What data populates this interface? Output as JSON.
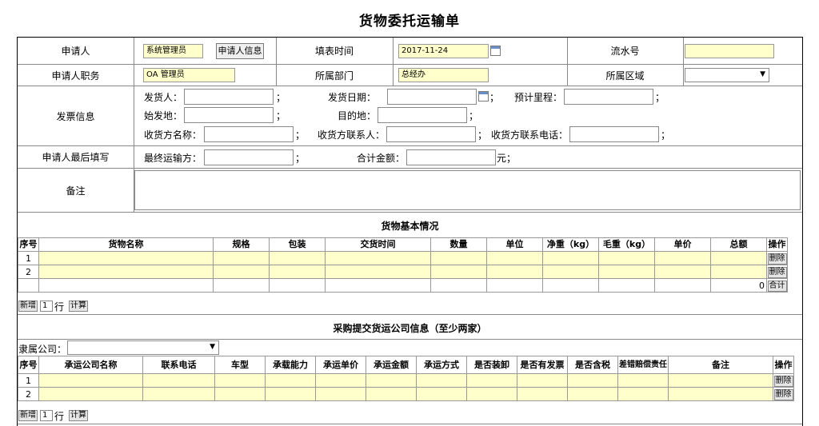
{
  "title": "货物委托运输单",
  "applicant_row": {
    "applicant_label": "申请人",
    "applicant_value": "系统管理员",
    "applicant_info_button": "申请人信息",
    "fill_time_label": "填表时间",
    "fill_time_value": "2017-11-24",
    "serial_label": "流水号",
    "serial_value": ""
  },
  "position_row": {
    "position_label": "申请人职务",
    "position_value": "OA 管理员",
    "dept_label": "所属部门",
    "dept_value": "总经办",
    "region_label": "所属区域",
    "region_value": ""
  },
  "invoice": {
    "label": "发票信息",
    "shipper": "发货人：",
    "ship_date": "发货日期：",
    "est_mileage": "预计里程：",
    "origin": "始发地：",
    "destination": "目的地：",
    "receiver_name": "收货方名称：",
    "receiver_contact": "收货方联系人：",
    "receiver_phone": "收货方联系电话：",
    "sep": "；"
  },
  "final": {
    "label": "申请人最后填写",
    "carrier": "最终运输方：",
    "total": "合计金额：",
    "unit": "元；",
    "sep": "；"
  },
  "remark_label": "备注",
  "goods": {
    "title": "货物基本情况",
    "headers": [
      "序号",
      "货物名称",
      "规格",
      "包装",
      "交货时间",
      "数量",
      "单位",
      "净重（kg）",
      "毛重（kg）",
      "单价",
      "总额",
      "操作"
    ],
    "rows": [
      "1",
      "2"
    ],
    "delete": "删除",
    "total_value": "0",
    "total_button": "合计",
    "add": "新增",
    "add_count": "1",
    "row_unit": "行",
    "calc": "计算"
  },
  "freight": {
    "title": "采购提交货运公司信息（至少两家）",
    "company_label": "隶属公司：",
    "company_value": "",
    "headers": [
      "序号",
      "承运公司名称",
      "联系电话",
      "车型",
      "承载能力",
      "承运单价",
      "承运金额",
      "承运方式",
      "是否装卸",
      "是否有发票",
      "是否含税",
      "差错赔偿责任",
      "备注",
      "操作"
    ],
    "rows": [
      "1",
      "2"
    ],
    "delete": "删除",
    "add": "新增",
    "add_count": "1",
    "row_unit": "行",
    "calc": "计算"
  },
  "icons": {
    "calendar": "calendar-icon",
    "dropdown": "chevron-down-icon"
  },
  "colors": {
    "highlight_field": "#ffffcc",
    "border": "#888888"
  }
}
